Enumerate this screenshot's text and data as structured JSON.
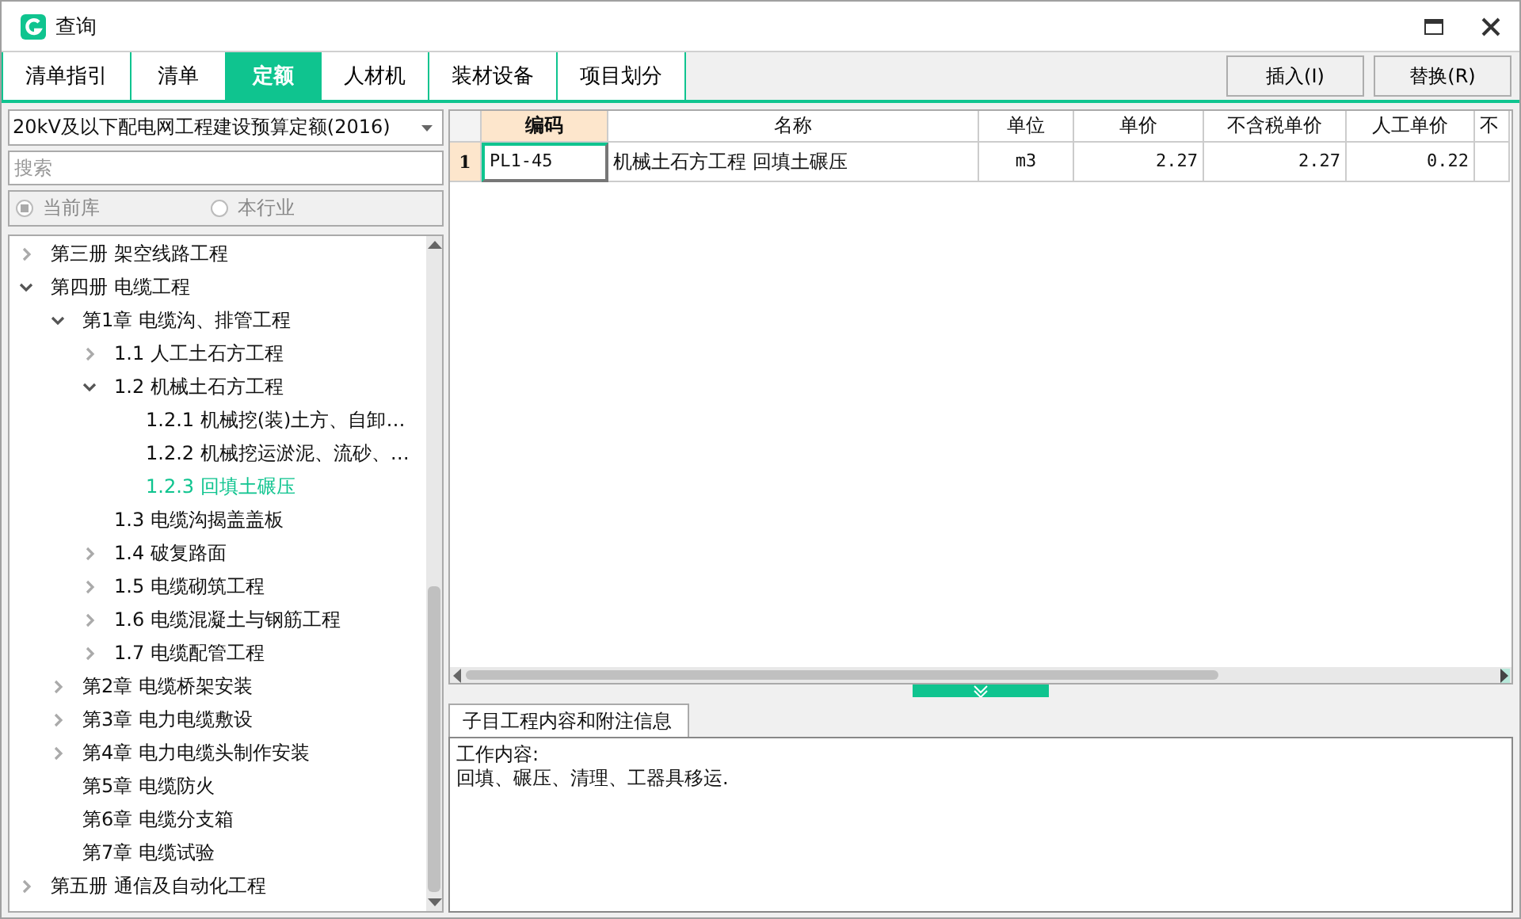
{
  "window": {
    "title": "查询"
  },
  "tabs": [
    {
      "label": "清单指引",
      "selected": false
    },
    {
      "label": "清单",
      "selected": false
    },
    {
      "label": "定额",
      "selected": true
    },
    {
      "label": "人材机",
      "selected": false
    },
    {
      "label": "装材设备",
      "selected": false
    },
    {
      "label": "项目划分",
      "selected": false
    }
  ],
  "buttons": [
    "插入(I)",
    "替换(R)"
  ],
  "library": {
    "value": "20kV及以下配电网工程建设预算定额(2016)"
  },
  "search": {
    "placeholder": "搜索"
  },
  "scope": [
    {
      "label": "当前库",
      "selected": true
    },
    {
      "label": "本行业",
      "selected": false
    }
  ],
  "tree": [
    {
      "label": "第三册 架空线路工程",
      "expanded": false,
      "selected": false
    },
    {
      "label": "第四册 电缆工程",
      "expanded": true,
      "selected": false,
      "children": [
        {
          "label": "第1章 电缆沟、排管工程",
          "expanded": true,
          "selected": false,
          "children": [
            {
              "label": "1.1 人工土石方工程",
              "expanded": false,
              "selected": false
            },
            {
              "label": "1.2 机械土石方工程",
              "expanded": true,
              "selected": false,
              "children": [
                {
                  "label": "1.2.1 机械挖(装)土方、自卸…",
                  "selected": false
                },
                {
                  "label": "1.2.2 机械挖运淤泥、流砂、…",
                  "selected": false
                },
                {
                  "label": "1.2.3 回填土碾压",
                  "selected": true
                }
              ]
            },
            {
              "label": "1.3 电缆沟揭盖盖板",
              "selected": false
            },
            {
              "label": "1.4 破复路面",
              "expanded": false,
              "selected": false
            },
            {
              "label": "1.5 电缆砌筑工程",
              "expanded": false,
              "selected": false
            },
            {
              "label": "1.6 电缆混凝土与钢筋工程",
              "expanded": false,
              "selected": false
            },
            {
              "label": "1.7 电缆配管工程",
              "expanded": false,
              "selected": false
            }
          ]
        },
        {
          "label": "第2章 电缆桥架安装",
          "expanded": false,
          "selected": false
        },
        {
          "label": "第3章 电力电缆敷设",
          "expanded": false,
          "selected": false
        },
        {
          "label": "第4章 电力电缆头制作安装",
          "expanded": false,
          "selected": false
        },
        {
          "label": "第5章 电缆防火",
          "selected": false
        },
        {
          "label": "第6章 电缆分支箱",
          "selected": false
        },
        {
          "label": "第7章 电缆试验",
          "selected": false
        }
      ]
    },
    {
      "label": "第五册 通信及自动化工程",
      "expanded": false,
      "selected": false
    }
  ],
  "table": {
    "columns": [
      {
        "label": "编码",
        "selected": true
      },
      {
        "label": "名称",
        "selected": false
      },
      {
        "label": "单位",
        "selected": false
      },
      {
        "label": "单价",
        "selected": false
      },
      {
        "label": "不含税单价",
        "selected": false
      },
      {
        "label": "人工单价",
        "selected": false
      },
      {
        "label": "不",
        "selected": false
      }
    ],
    "rows": [
      {
        "number": "1",
        "cells": [
          "PL1-45",
          "机械土石方工程 回填土碾压",
          "m3",
          "2.27",
          "2.27",
          "0.22",
          ""
        ]
      }
    ]
  },
  "detail": {
    "tab": "子目工程内容和附注信息",
    "lines": [
      "工作内容:",
      "回填、碾压、清理、工器具移运."
    ]
  }
}
